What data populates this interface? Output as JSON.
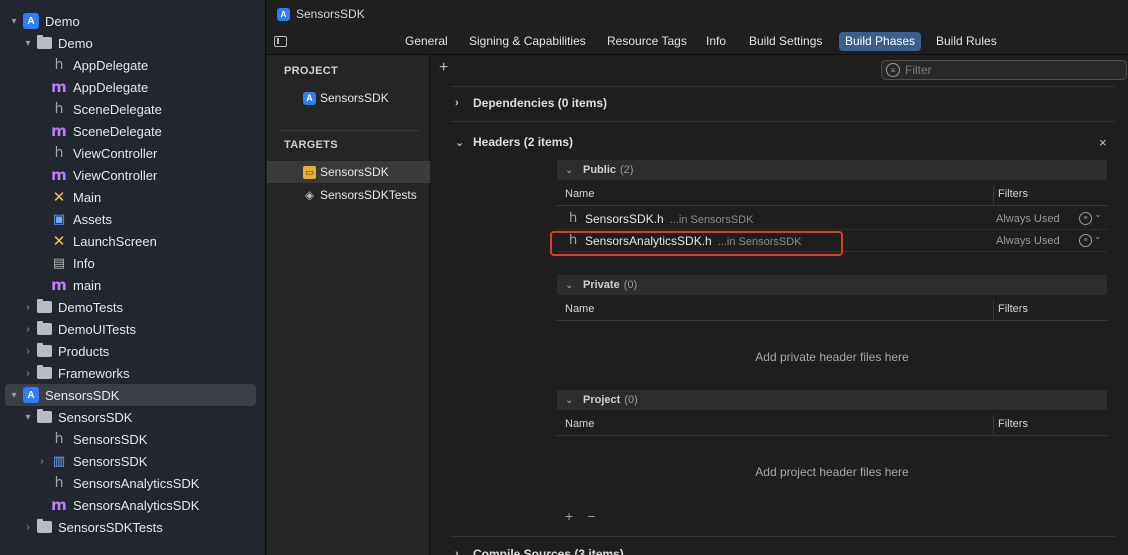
{
  "navigator": {
    "items": [
      {
        "label": "Demo",
        "indent": 0,
        "disclosure": "▾",
        "icon": "project-icon",
        "kind": "proj"
      },
      {
        "label": "Demo",
        "indent": 1,
        "disclosure": "▾",
        "icon": "folder-icon",
        "kind": "folder"
      },
      {
        "label": "AppDelegate",
        "indent": 2,
        "disclosure": "",
        "icon": "header-file-icon",
        "kind": "h"
      },
      {
        "label": "AppDelegate",
        "indent": 2,
        "disclosure": "",
        "icon": "objc-file-icon",
        "kind": "m"
      },
      {
        "label": "SceneDelegate",
        "indent": 2,
        "disclosure": "",
        "icon": "header-file-icon",
        "kind": "h"
      },
      {
        "label": "SceneDelegate",
        "indent": 2,
        "disclosure": "",
        "icon": "objc-file-icon",
        "kind": "m"
      },
      {
        "label": "ViewController",
        "indent": 2,
        "disclosure": "",
        "icon": "header-file-icon",
        "kind": "h"
      },
      {
        "label": "ViewController",
        "indent": 2,
        "disclosure": "",
        "icon": "objc-file-icon",
        "kind": "m"
      },
      {
        "label": "Main",
        "indent": 2,
        "disclosure": "",
        "icon": "storyboard-icon",
        "kind": "x"
      },
      {
        "label": "Assets",
        "indent": 2,
        "disclosure": "",
        "icon": "asset-catalog-icon",
        "kind": "assets"
      },
      {
        "label": "LaunchScreen",
        "indent": 2,
        "disclosure": "",
        "icon": "storyboard-icon",
        "kind": "x"
      },
      {
        "label": "Info",
        "indent": 2,
        "disclosure": "",
        "icon": "plist-icon",
        "kind": "info"
      },
      {
        "label": "main",
        "indent": 2,
        "disclosure": "",
        "icon": "objc-file-icon",
        "kind": "m"
      },
      {
        "label": "DemoTests",
        "indent": 1,
        "disclosure": "›",
        "icon": "folder-icon",
        "kind": "folder"
      },
      {
        "label": "DemoUITests",
        "indent": 1,
        "disclosure": "›",
        "icon": "folder-icon",
        "kind": "folder"
      },
      {
        "label": "Products",
        "indent": 1,
        "disclosure": "›",
        "icon": "folder-icon",
        "kind": "folder"
      },
      {
        "label": "Frameworks",
        "indent": 1,
        "disclosure": "›",
        "icon": "folder-icon",
        "kind": "folder"
      },
      {
        "label": "SensorsSDK",
        "indent": 0,
        "disclosure": "▾",
        "icon": "project-icon",
        "kind": "proj",
        "selected": true
      },
      {
        "label": "SensorsSDK",
        "indent": 1,
        "disclosure": "▾",
        "icon": "folder-icon",
        "kind": "folder"
      },
      {
        "label": "SensorsSDK",
        "indent": 2,
        "disclosure": "",
        "icon": "header-file-icon",
        "kind": "h"
      },
      {
        "label": "SensorsSDK",
        "indent": 2,
        "disclosure": "›",
        "icon": "framework-icon",
        "kind": "framework"
      },
      {
        "label": "SensorsAnalyticsSDK",
        "indent": 2,
        "disclosure": "",
        "icon": "header-file-icon",
        "kind": "h"
      },
      {
        "label": "SensorsAnalyticsSDK",
        "indent": 2,
        "disclosure": "",
        "icon": "objc-file-icon",
        "kind": "m"
      },
      {
        "label": "SensorsSDKTests",
        "indent": 1,
        "disclosure": "›",
        "icon": "folder-icon",
        "kind": "folder"
      }
    ]
  },
  "titlebar": {
    "title": "SensorsSDK"
  },
  "tabs": [
    "General",
    "Signing & Capabilities",
    "Resource Tags",
    "Info",
    "Build Settings",
    "Build Phases",
    "Build Rules"
  ],
  "active_tab": "Build Phases",
  "targets_panel": {
    "project_heading": "PROJECT",
    "project_item": "SensorsSDK",
    "targets_heading": "TARGETS",
    "targets": [
      "SensorsSDK",
      "SensorsSDKTests"
    ]
  },
  "phases": {
    "filter_placeholder": "Filter",
    "dependencies_title": "Dependencies (0 items)",
    "headers_title": "Headers (2 items)",
    "compile_title": "Compile Sources (3 items)",
    "col_name": "Name",
    "col_filters": "Filters",
    "public": {
      "label": "Public",
      "count": "(2)"
    },
    "private": {
      "label": "Private",
      "count": "(0)"
    },
    "project": {
      "label": "Project",
      "count": "(0)"
    },
    "public_rows": [
      {
        "name": "SensorsSDK.h",
        "location": "...in SensorsSDK",
        "filter": "Always Used"
      },
      {
        "name": "SensorsAnalyticsSDK.h",
        "location": "...in SensorsSDK",
        "filter": "Always Used"
      }
    ],
    "private_empty": "Add private header files here",
    "project_empty": "Add project header files here",
    "plus": "+",
    "minus": "−",
    "close": "×",
    "add": "+"
  },
  "colors": {
    "highlight": "#e03a2f",
    "active_tab": "#3b5f8d",
    "selection": "#3b4048"
  }
}
